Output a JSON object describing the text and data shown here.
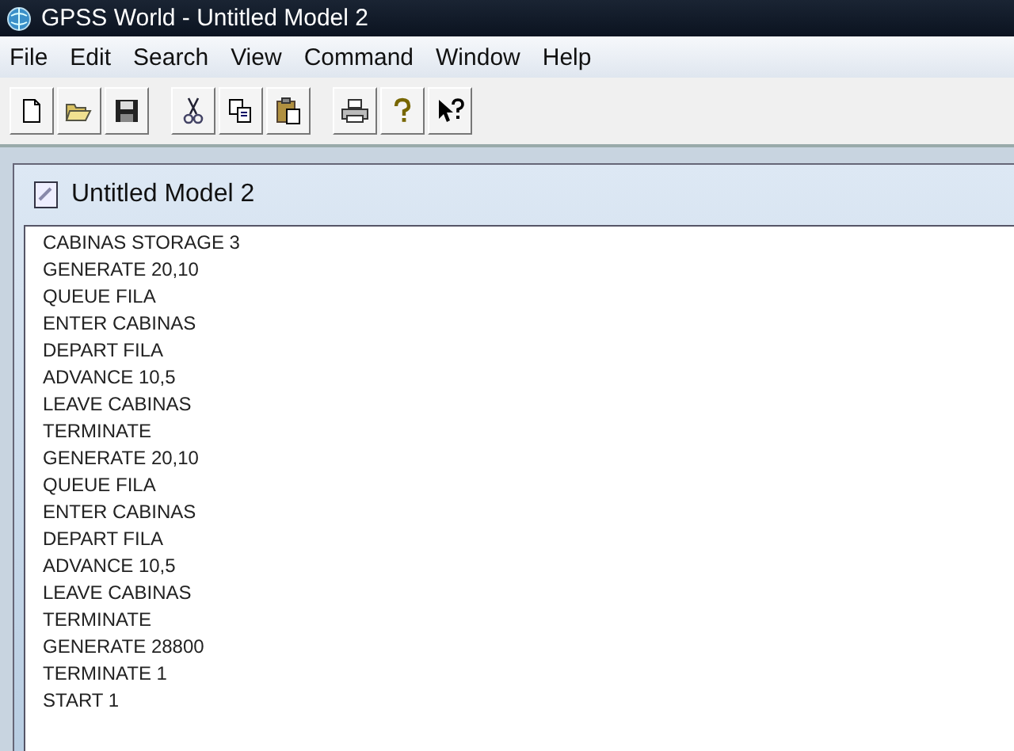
{
  "window": {
    "title": "GPSS World - Untitled Model 2"
  },
  "menu": [
    "File",
    "Edit",
    "Search",
    "View",
    "Command",
    "Window",
    "Help"
  ],
  "toolbar": [
    {
      "kind": "new"
    },
    {
      "kind": "open"
    },
    {
      "kind": "save"
    },
    {
      "kind": "sep"
    },
    {
      "kind": "cut"
    },
    {
      "kind": "copy"
    },
    {
      "kind": "paste"
    },
    {
      "kind": "sep"
    },
    {
      "kind": "print"
    },
    {
      "kind": "help"
    },
    {
      "kind": "context-help"
    }
  ],
  "document": {
    "title": "Untitled Model 2",
    "lines": [
      "CABINAS STORAGE 3",
      "GENERATE 20,10",
      "QUEUE FILA",
      "ENTER CABINAS",
      "DEPART FILA",
      "ADVANCE 10,5",
      "LEAVE CABINAS",
      "TERMINATE",
      "GENERATE 20,10",
      "QUEUE FILA",
      "ENTER CABINAS",
      "DEPART FILA",
      "ADVANCE 10,5",
      "LEAVE CABINAS",
      "TERMINATE",
      "GENERATE 28800",
      "TERMINATE 1",
      "START 1"
    ]
  }
}
